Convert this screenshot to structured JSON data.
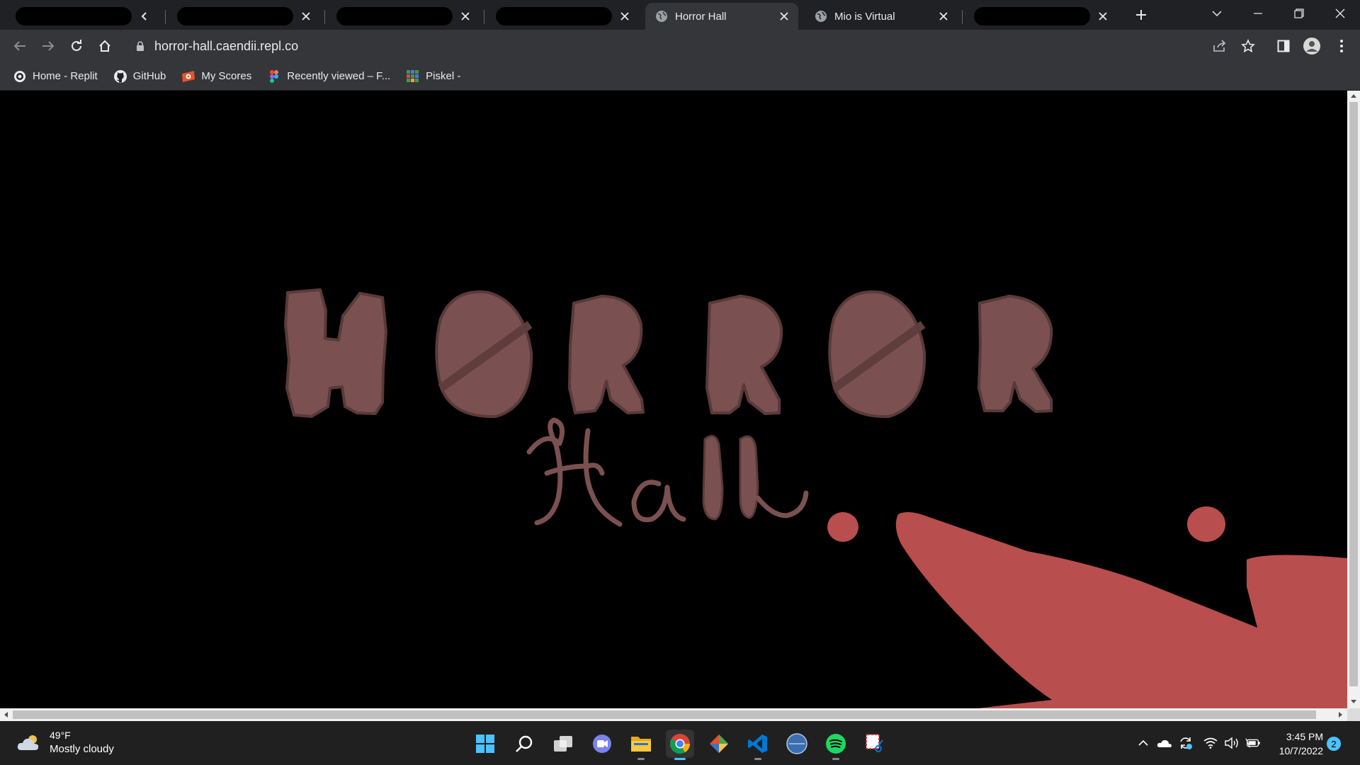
{
  "browser": {
    "tabs": [
      {
        "title": "",
        "redacted": true,
        "close_icon": "chevron-left-icon"
      },
      {
        "title": "",
        "redacted": true,
        "close_icon": "close-icon"
      },
      {
        "title": "",
        "redacted": true,
        "close_icon": "close-icon"
      },
      {
        "title": "",
        "redacted": true,
        "close_icon": "close-icon"
      },
      {
        "title": "Horror Hall",
        "active": true,
        "favicon": "globe-icon",
        "close_icon": "close-icon"
      },
      {
        "title": "Mio is Virtual",
        "favicon": "globe-icon",
        "close_icon": "close-icon"
      },
      {
        "title": "",
        "redacted": true,
        "close_icon": "close-icon"
      }
    ],
    "url": "horror-hall.caendii.repl.co",
    "bookmarks": [
      {
        "label": "Home - Replit",
        "icon": "replit-icon"
      },
      {
        "label": "GitHub",
        "icon": "github-icon"
      },
      {
        "label": "My Scores",
        "icon": "scores-icon"
      },
      {
        "label": "Recently viewed – F...",
        "icon": "figma-icon"
      },
      {
        "label": "Piskel -",
        "icon": "piskel-icon"
      }
    ]
  },
  "page": {
    "background_color": "#000000",
    "logo_text": "HORROR Hall",
    "logo_color": "#7a5150",
    "blood_color": "#b84e4d"
  },
  "taskbar": {
    "weather": {
      "temp": "49°F",
      "condition": "Mostly cloudy"
    },
    "time": "3:45 PM",
    "date": "10/7/2022",
    "notifications": "2",
    "apps": [
      "start-icon",
      "search-icon",
      "task-view-icon",
      "chat-icon",
      "file-explorer-icon",
      "chrome-icon",
      "git-icon",
      "vscode-icon",
      "app-icon",
      "spotify-icon",
      "snipping-tool-icon"
    ]
  }
}
